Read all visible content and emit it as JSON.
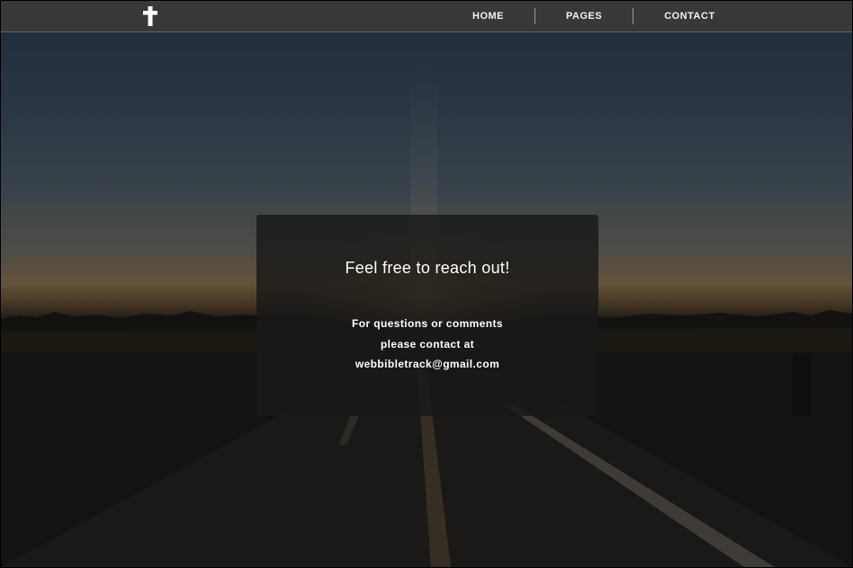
{
  "header": {
    "logo_icon": "cross-icon",
    "nav": [
      {
        "label": "HOME"
      },
      {
        "label": "PAGES"
      },
      {
        "label": "CONTACT"
      }
    ]
  },
  "hero": {
    "background": "sunset-road-photo",
    "card": {
      "title": "Feel free to reach out!",
      "lines": [
        "For questions or comments",
        "please contact at",
        "webbibletrack@gmail.com"
      ]
    }
  },
  "colors": {
    "navbar": "#383838",
    "card_bg": "#191919",
    "text": "#ffffff"
  }
}
